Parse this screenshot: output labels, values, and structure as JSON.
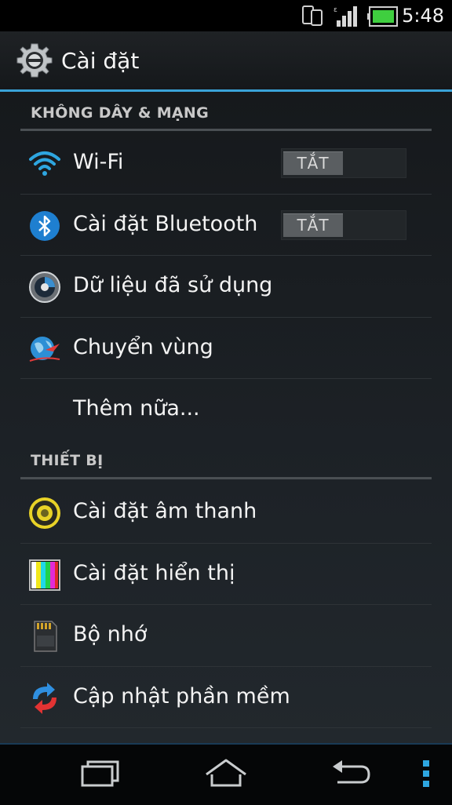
{
  "status_bar": {
    "time": "5:48",
    "icons": [
      "dual-phone-icon",
      "signal-strength-icon",
      "battery-icon"
    ]
  },
  "action_bar": {
    "title": "Cài đặt",
    "icon": "settings-gear-icon"
  },
  "sections": [
    {
      "header": "KHÔNG DÂY & MẠNG",
      "items": [
        {
          "label": "Wi-Fi",
          "icon": "wifi-icon",
          "toggle": "TẮT"
        },
        {
          "label": "Cài đặt Bluetooth",
          "icon": "bluetooth-icon",
          "toggle": "TẮT"
        },
        {
          "label": "Dữ liệu đã sử dụng",
          "icon": "data-usage-icon"
        },
        {
          "label": "Chuyển vùng",
          "icon": "roaming-globe-icon"
        },
        {
          "label": "Thêm nữa...",
          "icon": ""
        }
      ]
    },
    {
      "header": "THIẾT BỊ",
      "items": [
        {
          "label": "Cài đặt âm thanh",
          "icon": "sound-speaker-icon"
        },
        {
          "label": "Cài đặt hiển thị",
          "icon": "display-colorbars-icon"
        },
        {
          "label": "Bộ nhớ",
          "icon": "sd-card-icon"
        },
        {
          "label": "Cập nhật phần mềm",
          "icon": "software-update-icon"
        }
      ]
    }
  ],
  "nav_bar": {
    "buttons": [
      "recent-apps-icon",
      "home-icon",
      "back-icon",
      "menu-overflow-icon"
    ]
  },
  "colors": {
    "accent": "#3aa3d8",
    "background": "#16191c",
    "toggle_knob": "#5a5e61"
  }
}
